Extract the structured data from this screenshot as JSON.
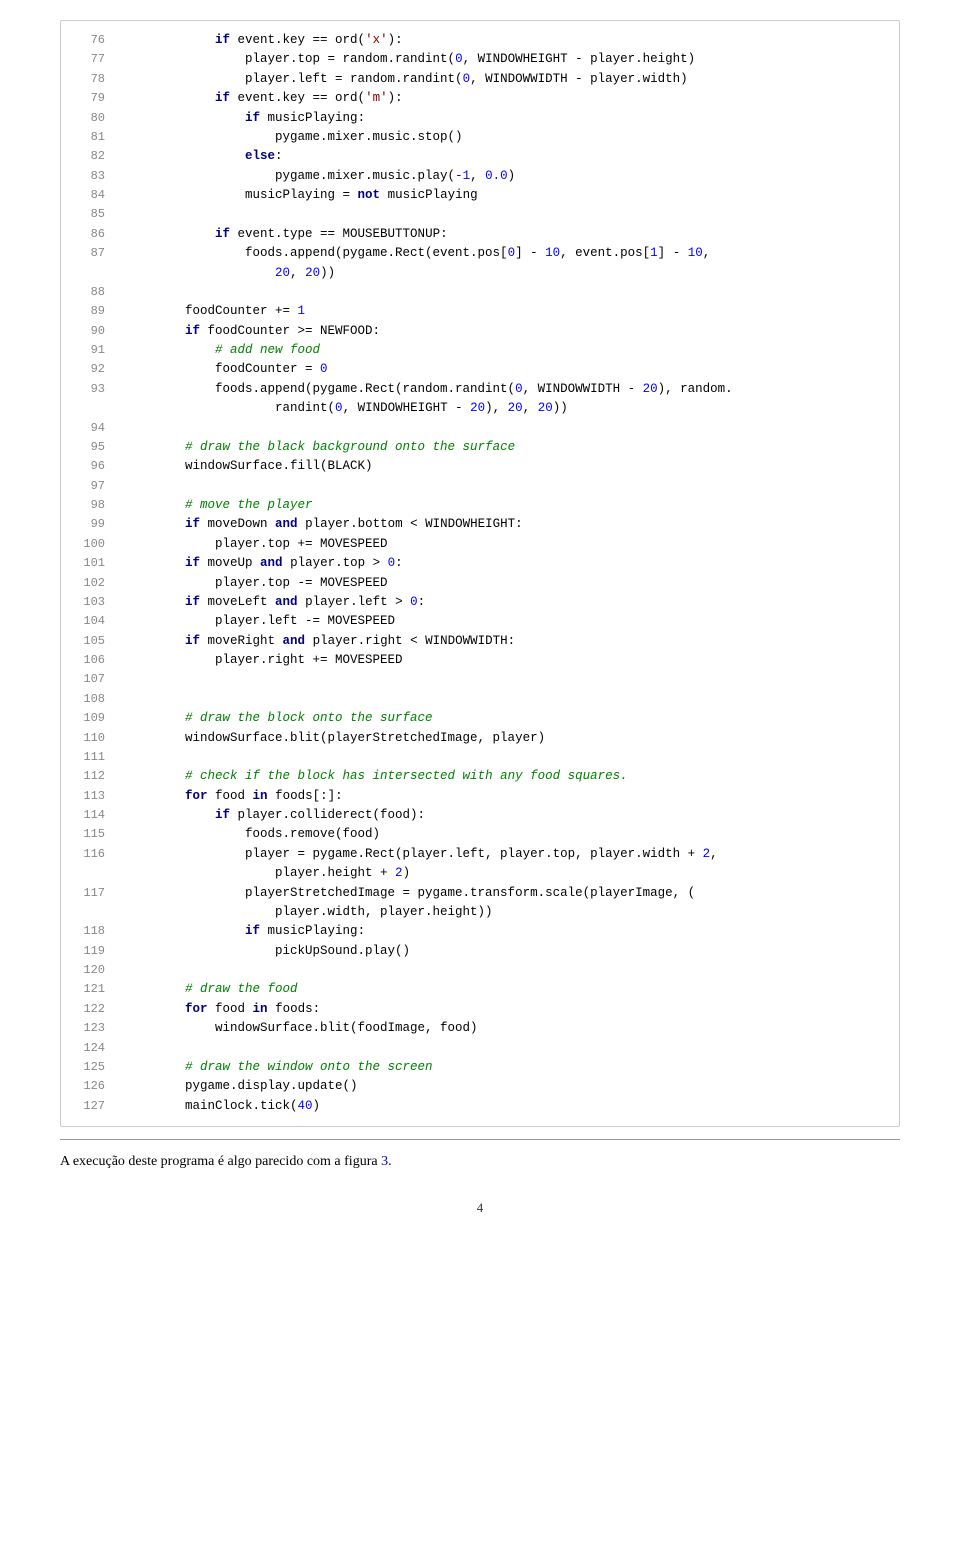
{
  "page": {
    "footer_page_num": "4"
  },
  "code": {
    "lines": [
      {
        "num": "76",
        "indent": 3,
        "content": "if event.key == ord('x'):"
      },
      {
        "num": "77",
        "indent": 4,
        "content": "player.top = random.randint(0, WINDOWHEIGHT - player.height)"
      },
      {
        "num": "78",
        "indent": 4,
        "content": "player.left = random.randint(0, WINDOWWIDTH - player.width)"
      },
      {
        "num": "79",
        "indent": 3,
        "content": "if event.key == ord('m'):"
      },
      {
        "num": "80",
        "indent": 4,
        "content": "if musicPlaying:"
      },
      {
        "num": "81",
        "indent": 5,
        "content": "pygame.mixer.music.stop()"
      },
      {
        "num": "82",
        "indent": 4,
        "content": "else:"
      },
      {
        "num": "83",
        "indent": 5,
        "content": "pygame.mixer.music.play(-1, 0.0)"
      },
      {
        "num": "84",
        "indent": 4,
        "content": "musicPlaying = not musicPlaying"
      },
      {
        "num": "85",
        "indent": 0,
        "content": ""
      },
      {
        "num": "86",
        "indent": 3,
        "content": "if event.type == MOUSEBUTTONUP:"
      },
      {
        "num": "87",
        "indent": 4,
        "content": "foods.append(pygame.Rect(event.pos[0] - 10, event.pos[1] - 10,"
      },
      {
        "num": "87b",
        "indent": 0,
        "content": "                    20, 20))"
      },
      {
        "num": "88",
        "indent": 0,
        "content": ""
      },
      {
        "num": "89",
        "indent": 2,
        "content": "foodCounter += 1"
      },
      {
        "num": "90",
        "indent": 2,
        "content": "if foodCounter >= NEWFOOD:"
      },
      {
        "num": "91",
        "indent": 3,
        "content": "# add new food"
      },
      {
        "num": "92",
        "indent": 3,
        "content": "foodCounter = 0"
      },
      {
        "num": "93",
        "indent": 3,
        "content": "foods.append(pygame.Rect(random.randint(0, WINDOWWIDTH - 20), random."
      },
      {
        "num": "93b",
        "indent": 0,
        "content": "                    randint(0, WINDOWHEIGHT - 20), 20, 20))"
      },
      {
        "num": "94",
        "indent": 0,
        "content": ""
      },
      {
        "num": "95",
        "indent": 2,
        "content": "# draw the black background onto the surface"
      },
      {
        "num": "96",
        "indent": 2,
        "content": "windowSurface.fill(BLACK)"
      },
      {
        "num": "97",
        "indent": 0,
        "content": ""
      },
      {
        "num": "98",
        "indent": 2,
        "content": "# move the player"
      },
      {
        "num": "99",
        "indent": 2,
        "content": "if moveDown and player.bottom < WINDOWHEIGHT:"
      },
      {
        "num": "100",
        "indent": 3,
        "content": "player.top += MOVESPEED"
      },
      {
        "num": "101",
        "indent": 2,
        "content": "if moveUp and player.top > 0:"
      },
      {
        "num": "102",
        "indent": 3,
        "content": "player.top -= MOVESPEED"
      },
      {
        "num": "103",
        "indent": 2,
        "content": "if moveLeft and player.left > 0:"
      },
      {
        "num": "104",
        "indent": 3,
        "content": "player.left -= MOVESPEED"
      },
      {
        "num": "105",
        "indent": 2,
        "content": "if moveRight and player.right < WINDOWWIDTH:"
      },
      {
        "num": "106",
        "indent": 3,
        "content": "player.right += MOVESPEED"
      },
      {
        "num": "107",
        "indent": 0,
        "content": ""
      },
      {
        "num": "108",
        "indent": 0,
        "content": ""
      },
      {
        "num": "109",
        "indent": 2,
        "content": "# draw the block onto the surface"
      },
      {
        "num": "110",
        "indent": 2,
        "content": "windowSurface.blit(playerStretchedImage, player)"
      },
      {
        "num": "111",
        "indent": 0,
        "content": ""
      },
      {
        "num": "112",
        "indent": 2,
        "content": "# check if the block has intersected with any food squares."
      },
      {
        "num": "113",
        "indent": 2,
        "content": "for food in foods[:]:"
      },
      {
        "num": "114",
        "indent": 3,
        "content": "if player.colliderect(food):"
      },
      {
        "num": "115",
        "indent": 4,
        "content": "foods.remove(food)"
      },
      {
        "num": "116",
        "indent": 4,
        "content": "player = pygame.Rect(player.left, player.top, player.width + 2,"
      },
      {
        "num": "116b",
        "indent": 0,
        "content": "                    player.height + 2)"
      },
      {
        "num": "117",
        "indent": 4,
        "content": "playerStretchedImage = pygame.transform.scale(playerImage, ("
      },
      {
        "num": "117b",
        "indent": 0,
        "content": "                    player.width, player.height))"
      },
      {
        "num": "118",
        "indent": 4,
        "content": "if musicPlaying:"
      },
      {
        "num": "119",
        "indent": 5,
        "content": "pickUpSound.play()"
      },
      {
        "num": "120",
        "indent": 0,
        "content": ""
      },
      {
        "num": "121",
        "indent": 2,
        "content": "# draw the food"
      },
      {
        "num": "122",
        "indent": 2,
        "content": "for food in foods:"
      },
      {
        "num": "123",
        "indent": 3,
        "content": "windowSurface.blit(foodImage, food)"
      },
      {
        "num": "124",
        "indent": 0,
        "content": ""
      },
      {
        "num": "125",
        "indent": 2,
        "content": "# draw the window onto the screen"
      },
      {
        "num": "126",
        "indent": 2,
        "content": "pygame.display.update()"
      },
      {
        "num": "127",
        "indent": 2,
        "content": "mainClock.tick(40)"
      }
    ]
  },
  "prose": {
    "text_before_link": "A execução deste programa é algo parecido com a figura ",
    "link_text": "3",
    "text_after_link": "."
  }
}
